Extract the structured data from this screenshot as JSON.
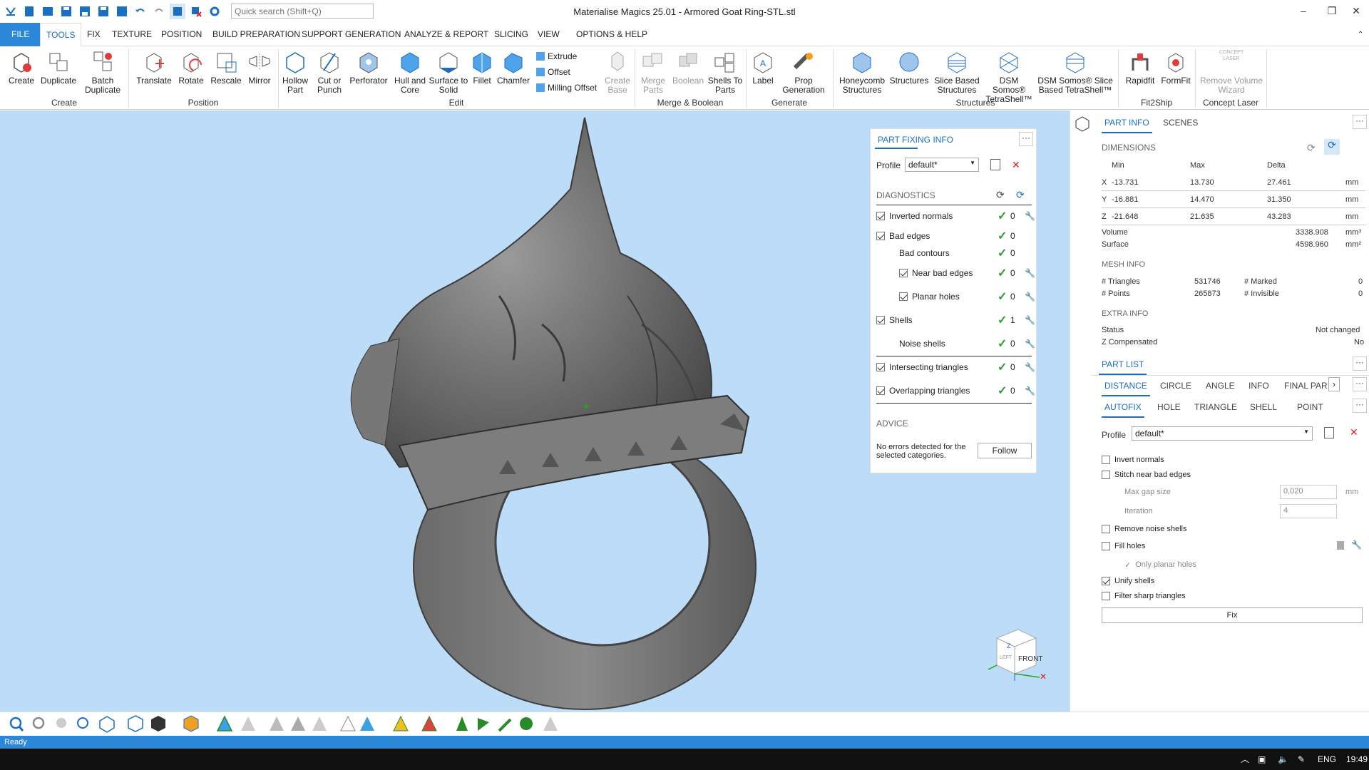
{
  "window": {
    "title": "Materialise Magics 25.01 - Armored Goat Ring-STL.stl",
    "search_placeholder": "Quick search (Shift+Q)"
  },
  "menu": [
    "FILE",
    "TOOLS",
    "FIX",
    "TEXTURE",
    "POSITION",
    "BUILD PREPARATION",
    "SUPPORT GENERATION",
    "ANALYZE & REPORT",
    "SLICING",
    "VIEW",
    "OPTIONS & HELP"
  ],
  "ribbon": {
    "buttons": [
      {
        "l1": "Create",
        "l2": ""
      },
      {
        "l1": "Duplicate",
        "l2": ""
      },
      {
        "l1": "Batch",
        "l2": "Duplicate"
      },
      {
        "l1": "Translate",
        "l2": ""
      },
      {
        "l1": "Rotate",
        "l2": ""
      },
      {
        "l1": "Rescale",
        "l2": ""
      },
      {
        "l1": "Mirror",
        "l2": ""
      },
      {
        "l1": "Hollow",
        "l2": "Part"
      },
      {
        "l1": "Cut or",
        "l2": "Punch"
      },
      {
        "l1": "Perforator",
        "l2": ""
      },
      {
        "l1": "Hull and",
        "l2": "Core"
      },
      {
        "l1": "Surface to",
        "l2": "Solid"
      },
      {
        "l1": "Fillet",
        "l2": ""
      },
      {
        "l1": "Chamfer",
        "l2": ""
      },
      {
        "l1": "Create",
        "l2": "Base"
      },
      {
        "l1": "Merge",
        "l2": "Parts"
      },
      {
        "l1": "Boolean",
        "l2": ""
      },
      {
        "l1": "Shells To",
        "l2": "Parts"
      },
      {
        "l1": "Label",
        "l2": ""
      },
      {
        "l1": "Prop",
        "l2": "Generation"
      },
      {
        "l1": "Honeycomb",
        "l2": "Structures"
      },
      {
        "l1": "Structures",
        "l2": ""
      },
      {
        "l1": "Slice Based",
        "l2": "Structures"
      },
      {
        "l1": "DSM Somos®",
        "l2": "TetraShell™"
      },
      {
        "l1": "DSM Somos® Slice",
        "l2": "Based TetraShell™"
      },
      {
        "l1": "Rapidfit",
        "l2": ""
      },
      {
        "l1": "FormFit",
        "l2": ""
      },
      {
        "l1": "Remove Volume",
        "l2": "Wizard"
      }
    ],
    "small": [
      "Extrude",
      "Offset",
      "Milling Offset"
    ],
    "concept_badge": "CONCEPT\nLASER",
    "groups": [
      "Create",
      "Position",
      "Edit",
      "Merge & Boolean",
      "Generate",
      "Structures",
      "Fit2Ship",
      "Concept Laser"
    ]
  },
  "pfi": {
    "title": "PART FIXING INFO",
    "profile_label": "Profile",
    "profile_value": "default*",
    "diagnostics_label": "DIAGNOSTICS",
    "items": [
      {
        "label": "Inverted normals",
        "count": "0"
      },
      {
        "label": "Bad edges",
        "count": "0"
      },
      {
        "label": "Bad contours",
        "count": "0"
      },
      {
        "label": "Near bad edges",
        "count": "0"
      },
      {
        "label": "Planar holes",
        "count": "0"
      },
      {
        "label": "Shells",
        "count": "1"
      },
      {
        "label": "Noise shells",
        "count": "0"
      },
      {
        "label": "Intersecting triangles",
        "count": "0"
      },
      {
        "label": "Overlapping triangles",
        "count": "0"
      }
    ],
    "advice_label": "ADVICE",
    "advice_text1": "No errors detected for the",
    "advice_text2": "selected categories.",
    "follow": "Follow"
  },
  "right": {
    "tabs": [
      "PART INFO",
      "SCENES"
    ],
    "dimensions": "DIMENSIONS",
    "cols": [
      "Min",
      "Max",
      "Delta"
    ],
    "dims": [
      {
        "axis": "X",
        "min": "-13.731",
        "max": "13.730",
        "delta": "27.461",
        "unit": "mm"
      },
      {
        "axis": "Y",
        "min": "-16.881",
        "max": "14.470",
        "delta": "31.350",
        "unit": "mm"
      },
      {
        "axis": "Z",
        "min": "-21.648",
        "max": "21.635",
        "delta": "43.283",
        "unit": "mm"
      }
    ],
    "volume_label": "Volume",
    "volume": "3338.908",
    "volume_unit": "mm³",
    "surface_label": "Surface",
    "surface": "4598.960",
    "surface_unit": "mm²",
    "mesh_info": "MESH INFO",
    "triangles_label": "# Triangles",
    "triangles": "531746",
    "marked_label": "# Marked",
    "marked": "0",
    "points_label": "# Points",
    "points": "265873",
    "invisible_label": "# Invisible",
    "invisible": "0",
    "extra_info": "EXTRA INFO",
    "status_label": "Status",
    "status": "Not changed",
    "zcomp_label": "Z Compensated",
    "zcomp": "No",
    "part_list": "PART LIST",
    "tabs2": [
      "DISTANCE",
      "CIRCLE",
      "ANGLE",
      "INFO",
      "FINAL PAR"
    ],
    "tabs3": [
      "AUTOFIX",
      "HOLE",
      "TRIANGLE",
      "SHELL",
      "POINT"
    ],
    "profile_label": "Profile",
    "profile_value": "default*",
    "opts": [
      "Invert normals",
      "Stitch near bad edges",
      "Remove noise shells",
      "Fill holes",
      "Only planar holes",
      "Unify shells",
      "Filter sharp triangles"
    ],
    "max_gap_label": "Max gap size",
    "max_gap": "0,020",
    "max_gap_unit": "mm",
    "iteration_label": "Iteration",
    "iteration": "4",
    "fix": "Fix"
  },
  "viewcube": {
    "front": "FRONT",
    "left": "LEFT",
    "z": "Z"
  },
  "status": "Ready",
  "taskbar": {
    "lang": "ENG",
    "time": "19:49"
  }
}
